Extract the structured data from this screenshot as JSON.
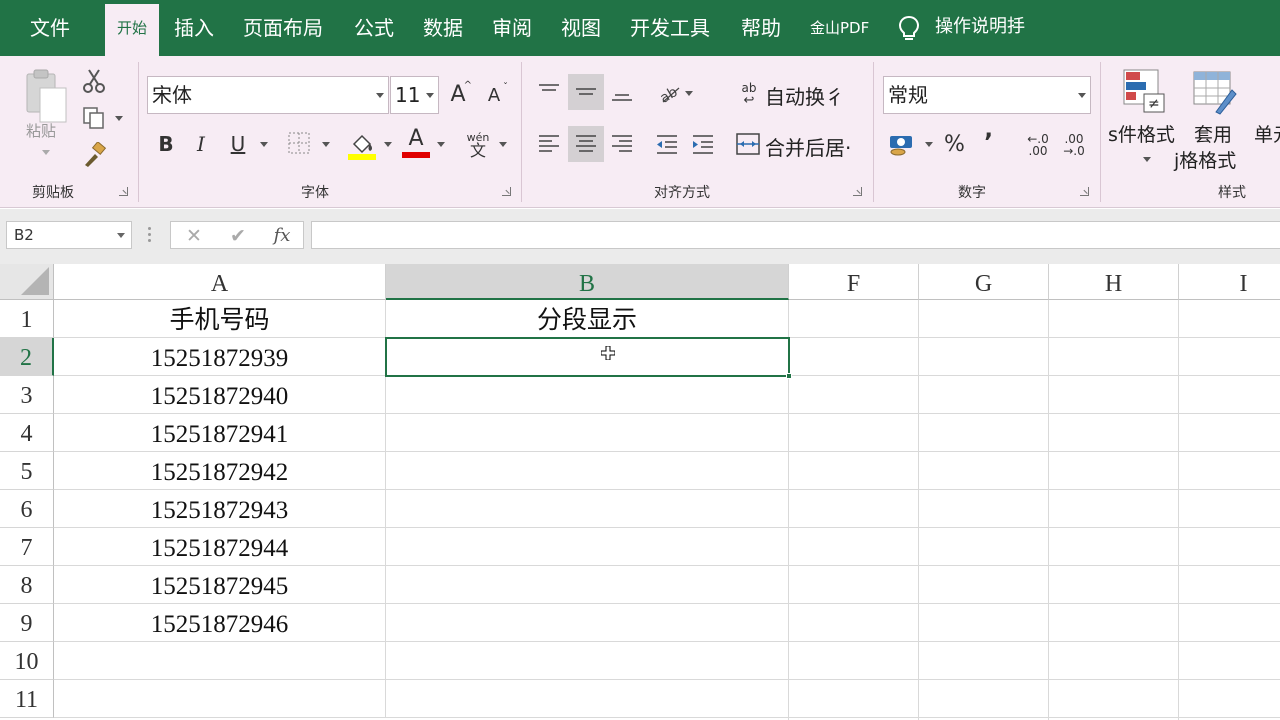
{
  "tabs": {
    "file": "文件",
    "home": "开始",
    "insert": "插入",
    "page_layout": "页面布局",
    "formulas": "公式",
    "data": "数据",
    "review": "审阅",
    "view": "视图",
    "developer": "开发工具",
    "help": "帮助",
    "pdf": "金山PDF",
    "tell_me": "操作说明抙"
  },
  "ribbon": {
    "clipboard": {
      "paste_label": "粘贴",
      "group_label": "剪贴板"
    },
    "font": {
      "font_name": "宋体",
      "font_size": "11",
      "bold": "B",
      "italic": "I",
      "underline": "U",
      "grow_font": "A",
      "shrink_font": "A",
      "font_color_letter": "A",
      "phonetic_top": "wén",
      "phonetic_bottom": "文",
      "group_label": "字体"
    },
    "alignment": {
      "wrap_text": "自动换彳",
      "wrap_icon_text": "ab",
      "merge_center": "合并后居·",
      "group_label": "对齐方式"
    },
    "number": {
      "format": "常规",
      "percent": "%",
      "comma": "’",
      "inc_decimal_top": "←.0",
      "inc_decimal_bottom": ".00",
      "dec_decimal_top": ".00",
      "dec_decimal_bottom": "→.0",
      "group_label": "数字"
    },
    "styles": {
      "conditional_format": "ѕ件格式",
      "format_as_table_line1": "套用",
      "format_as_table_line2": "ј格格式",
      "cell_styles": "单元",
      "group_label": "样式"
    }
  },
  "formula_bar": {
    "name_box": "B2",
    "cancel": "✕",
    "enter": "✔",
    "fx": "fx",
    "value": ""
  },
  "grid": {
    "columns": [
      "A",
      "B",
      "F",
      "G",
      "H",
      "I"
    ],
    "active_column": "B",
    "rows": [
      "1",
      "2",
      "3",
      "4",
      "5",
      "6",
      "7",
      "8",
      "9",
      "10",
      "11"
    ],
    "active_row": "2",
    "header_row": {
      "a": "手机号码",
      "b": "分段显示"
    },
    "phone_numbers": [
      "15251872939",
      "15251872940",
      "15251872941",
      "15251872942",
      "15251872943",
      "15251872944",
      "15251872945",
      "15251872946"
    ]
  },
  "colors": {
    "accent": "#217346",
    "ribbon_bg": "#f7ecf4",
    "fill_color": "#ffff00",
    "font_color": "#e00000"
  }
}
